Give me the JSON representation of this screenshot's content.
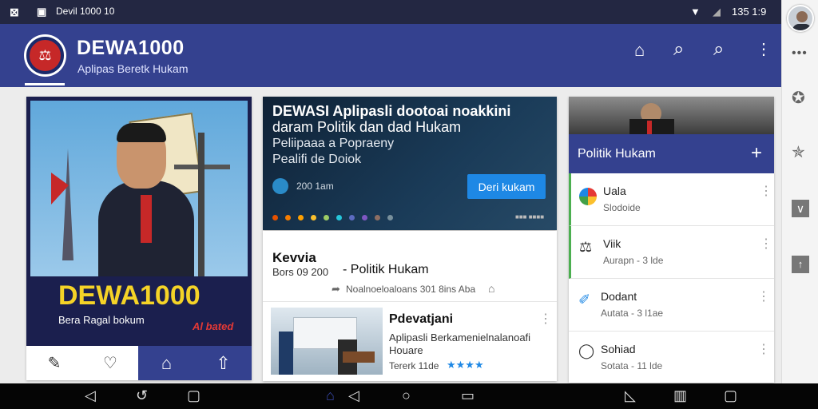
{
  "status": {
    "app_name": "Devil 1000 10",
    "time": "135 1:9"
  },
  "header": {
    "title": "DEWA1000",
    "subtitle": "Aplipas Beretk Hukam"
  },
  "promo": {
    "brand": "DEWA1000",
    "tagline": "Bera Ragal bokum",
    "badge": "Al bated"
  },
  "bottom_tabs": [
    "edit-icon",
    "heart-icon",
    "home-icon",
    "share-home-icon"
  ],
  "banner": {
    "line1": "DEWASI Aplipasli dootoai noakkini",
    "line2": "daram Politik dan dad Hukam",
    "line3": "Peliipaaa a Popraeny",
    "line4": "Pealifi de Doiok",
    "meta": "200 1am",
    "cta": "Deri kukam",
    "pager": "■■■ ■■■■"
  },
  "feed": {
    "title": "Kevvia",
    "date": "Bors 09 200",
    "category": "- Politik Hukam",
    "meta": "Noalnoeloaloans 301 8ins Aba",
    "article_title": "Pdevatjani",
    "article_desc1": "Aplipasli Berkamenielnalanoafi",
    "article_desc2": "Houare",
    "article_meta": "Tererk 11de",
    "stars": "★★★★"
  },
  "side": {
    "header": "Politik Hukam",
    "add": "+",
    "items": [
      {
        "title": "Uala",
        "sub": "Slodoide",
        "icon": "globe-icon"
      },
      {
        "title": "Viik",
        "sub": "Aurapn - 3 lde",
        "icon": "scale-icon"
      },
      {
        "title": "Dodant",
        "sub": "Autata - 3 l1ae",
        "icon": "pen-icon"
      },
      {
        "title": "Sohiad",
        "sub": "Sotata - 11 lde",
        "icon": "chat-icon"
      }
    ]
  },
  "colors": {
    "primary": "#34418f",
    "status": "#232742",
    "accent": "#1e88e5",
    "gold": "#f5d327"
  }
}
